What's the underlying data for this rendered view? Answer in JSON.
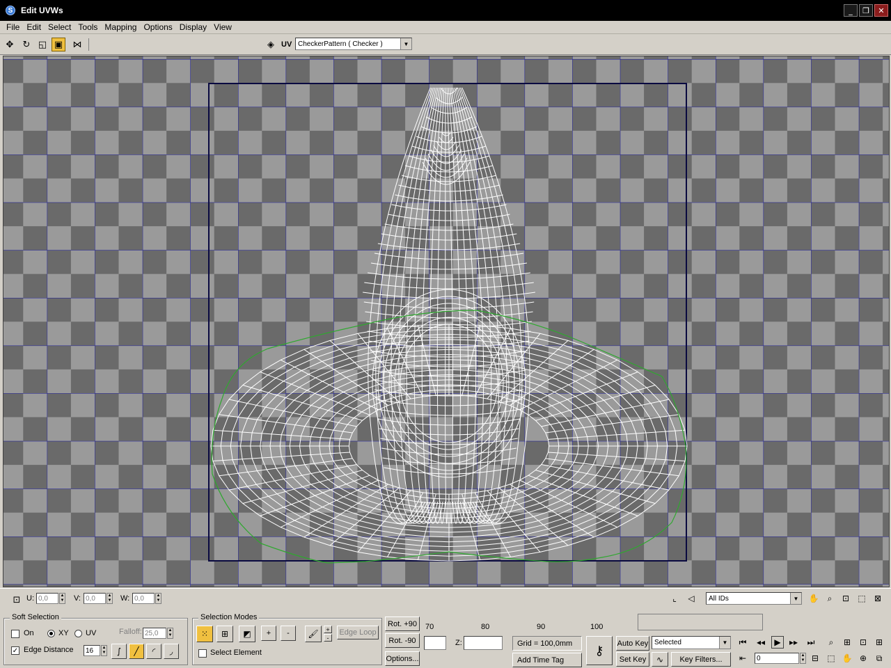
{
  "window": {
    "title": "Edit UVWs",
    "app_icon": "3ds-max-icon"
  },
  "menu": [
    "File",
    "Edit",
    "Select",
    "Tools",
    "Mapping",
    "Options",
    "Display",
    "View"
  ],
  "toolbar": {
    "uv_label": "UV",
    "texture_select": "CheckerPattern  ( Checker )"
  },
  "coords": {
    "u_label": "U:",
    "u_value": "0,0",
    "v_label": "V:",
    "v_value": "0,0",
    "w_label": "W:",
    "w_value": "0,0",
    "ids_select": "All IDs"
  },
  "soft_selection": {
    "title": "Soft Selection",
    "on_label": "On",
    "xy_label": "XY",
    "uv_label": "UV",
    "falloff_label": "Falloff:",
    "falloff_value": "25,0",
    "edge_distance_label": "Edge Distance",
    "edge_distance_value": "16"
  },
  "selection_modes": {
    "title": "Selection Modes",
    "plus": "+",
    "minus": "-",
    "edge_loop": "Edge Loop",
    "select_element": "Select Element"
  },
  "rotate": {
    "rot_plus": "Rot. +90",
    "rot_minus": "Rot. -90",
    "options": "Options..."
  },
  "timeline": {
    "ticks": [
      "70",
      "80",
      "90",
      "100"
    ]
  },
  "status": {
    "z_label": "Z:",
    "grid": "Grid = 100,0mm",
    "add_time_tag": "Add Time Tag",
    "auto_key": "Auto Key",
    "set_key": "Set Key",
    "key_mode_select": "Selected",
    "key_filters": "Key Filters...",
    "frame_value": "0"
  },
  "colors": {
    "checker_light": "#9a9a9a",
    "checker_dark": "#6a6a6a",
    "grid_line": "#1c1ca0",
    "uv_boundary": "#0a0a40",
    "wire": "#ffffff",
    "seam": "#2fa82f",
    "active_tool": "#f0c040"
  }
}
